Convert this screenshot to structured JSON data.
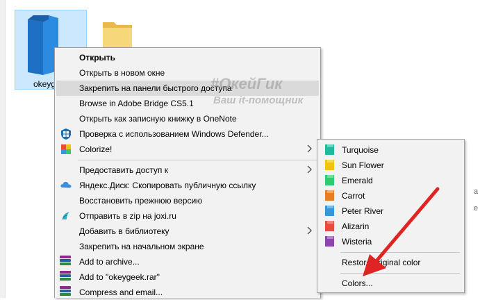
{
  "explorer": {
    "file_label": "okeyg",
    "right_cut_1": "a",
    "right_cut_2": "e"
  },
  "watermark": {
    "line1": "#ОкейГик",
    "line2": "Ваш it-помощник"
  },
  "context_menu": {
    "items": [
      {
        "label": "Открыть",
        "icon": "none"
      },
      {
        "label": "Открыть в новом окне",
        "icon": "none"
      },
      {
        "label": "Закрепить на панели быстрого доступа",
        "icon": "none"
      },
      {
        "label": "Browse in Adobe Bridge CS5.1",
        "icon": "none"
      },
      {
        "label": "Открыть как записную книжку в OneNote",
        "icon": "none"
      },
      {
        "label": "Проверка с использованием Windows Defender...",
        "icon": "windows-defender-icon"
      },
      {
        "label": "Colorize!",
        "icon": "colorize-icon"
      },
      {
        "label": "Предоставить доступ к",
        "icon": "none"
      },
      {
        "label": "Яндекс.Диск: Скопировать публичную ссылку",
        "icon": "yandex-disk-icon"
      },
      {
        "label": "Восстановить прежнюю версию",
        "icon": "none"
      },
      {
        "label": "Отправить в zip на joxi.ru",
        "icon": "joxi-icon"
      },
      {
        "label": "Добавить в библиотеку",
        "icon": "none"
      },
      {
        "label": "Закрепить на начальном экране",
        "icon": "none"
      },
      {
        "label": "Add to archive...",
        "icon": "winrar-icon"
      },
      {
        "label": "Add to \"okeygeek.rar\"",
        "icon": "winrar-icon"
      },
      {
        "label": "Compress and email...",
        "icon": "winrar-icon"
      }
    ]
  },
  "colorize_submenu": {
    "colors": [
      {
        "label": "Turquoise",
        "color": "#1abc9c"
      },
      {
        "label": "Sun Flower",
        "color": "#f1c40f"
      },
      {
        "label": "Emerald",
        "color": "#2ecc71"
      },
      {
        "label": "Carrot",
        "color": "#e67e22"
      },
      {
        "label": "Peter River",
        "color": "#3498db"
      },
      {
        "label": "Alizarin",
        "color": "#e74c3c"
      },
      {
        "label": "Wisteria",
        "color": "#8e44ad"
      }
    ],
    "restore_label": "Restore original color",
    "colors_label": "Colors..."
  },
  "accent": {
    "selection": "#cce8ff",
    "arrow": "#e02424"
  }
}
